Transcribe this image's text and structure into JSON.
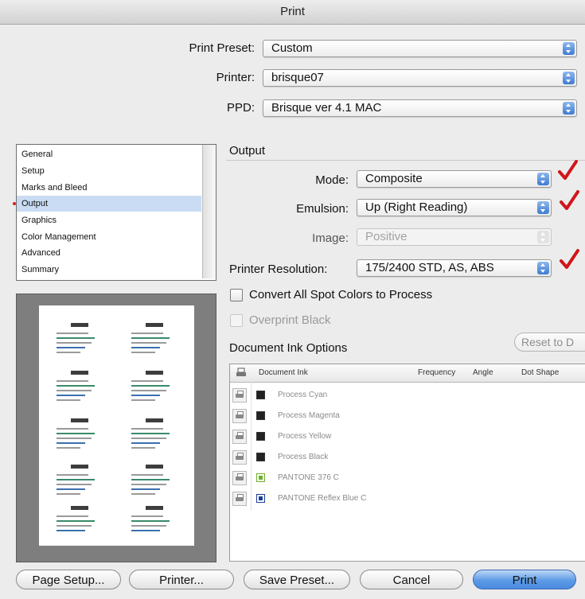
{
  "window": {
    "title": "Print"
  },
  "header": {
    "print_preset": {
      "label": "Print Preset:",
      "value": "Custom"
    },
    "printer": {
      "label": "Printer:",
      "value": "brisque07"
    },
    "ppd": {
      "label": "PPD:",
      "value": "Brisque ver 4.1 MAC"
    }
  },
  "categories": {
    "items": [
      "General",
      "Setup",
      "Marks and Bleed",
      "Output",
      "Graphics",
      "Color Management",
      "Advanced",
      "Summary"
    ],
    "selected": "Output"
  },
  "output": {
    "section_title": "Output",
    "mode": {
      "label": "Mode:",
      "value": "Composite"
    },
    "emulsion": {
      "label": "Emulsion:",
      "value": "Up (Right Reading)"
    },
    "image": {
      "label": "Image:",
      "value": "Positive",
      "disabled": true
    },
    "resolution": {
      "label": "Printer Resolution:",
      "value": "175/2400 STD, AS, ABS"
    },
    "convert_spot": {
      "label": "Convert All Spot Colors to Process",
      "checked": false
    },
    "overprint_black": {
      "label": "Overprint Black",
      "checked": false,
      "disabled": true
    }
  },
  "ink_options": {
    "title": "Document Ink Options",
    "reset_button": "Reset to D",
    "columns": [
      "Document Ink",
      "Frequency",
      "Angle",
      "Dot Shape"
    ],
    "rows": [
      {
        "name": "Process Cyan",
        "swatch": "process",
        "color": "#222222"
      },
      {
        "name": "Process Magenta",
        "swatch": "process",
        "color": "#222222"
      },
      {
        "name": "Process Yellow",
        "swatch": "process",
        "color": "#222222"
      },
      {
        "name": "Process Black",
        "swatch": "process",
        "color": "#222222"
      },
      {
        "name": "PANTONE 376 C",
        "swatch": "spot",
        "color": "#6fae2c"
      },
      {
        "name": "PANTONE Reflex Blue C",
        "swatch": "spot",
        "color": "#1b3d95"
      }
    ]
  },
  "buttons": {
    "page_setup": "Page Setup...",
    "printer": "Printer...",
    "save_preset": "Save Preset...",
    "cancel": "Cancel",
    "print": "Print"
  },
  "colors": {
    "accent": "#4a8ae0",
    "check_mark": "#d0151b",
    "selection": "#c9dcf3"
  },
  "icons": {
    "check_marks": "red-check-icon",
    "ink_print": "printer-icon"
  }
}
